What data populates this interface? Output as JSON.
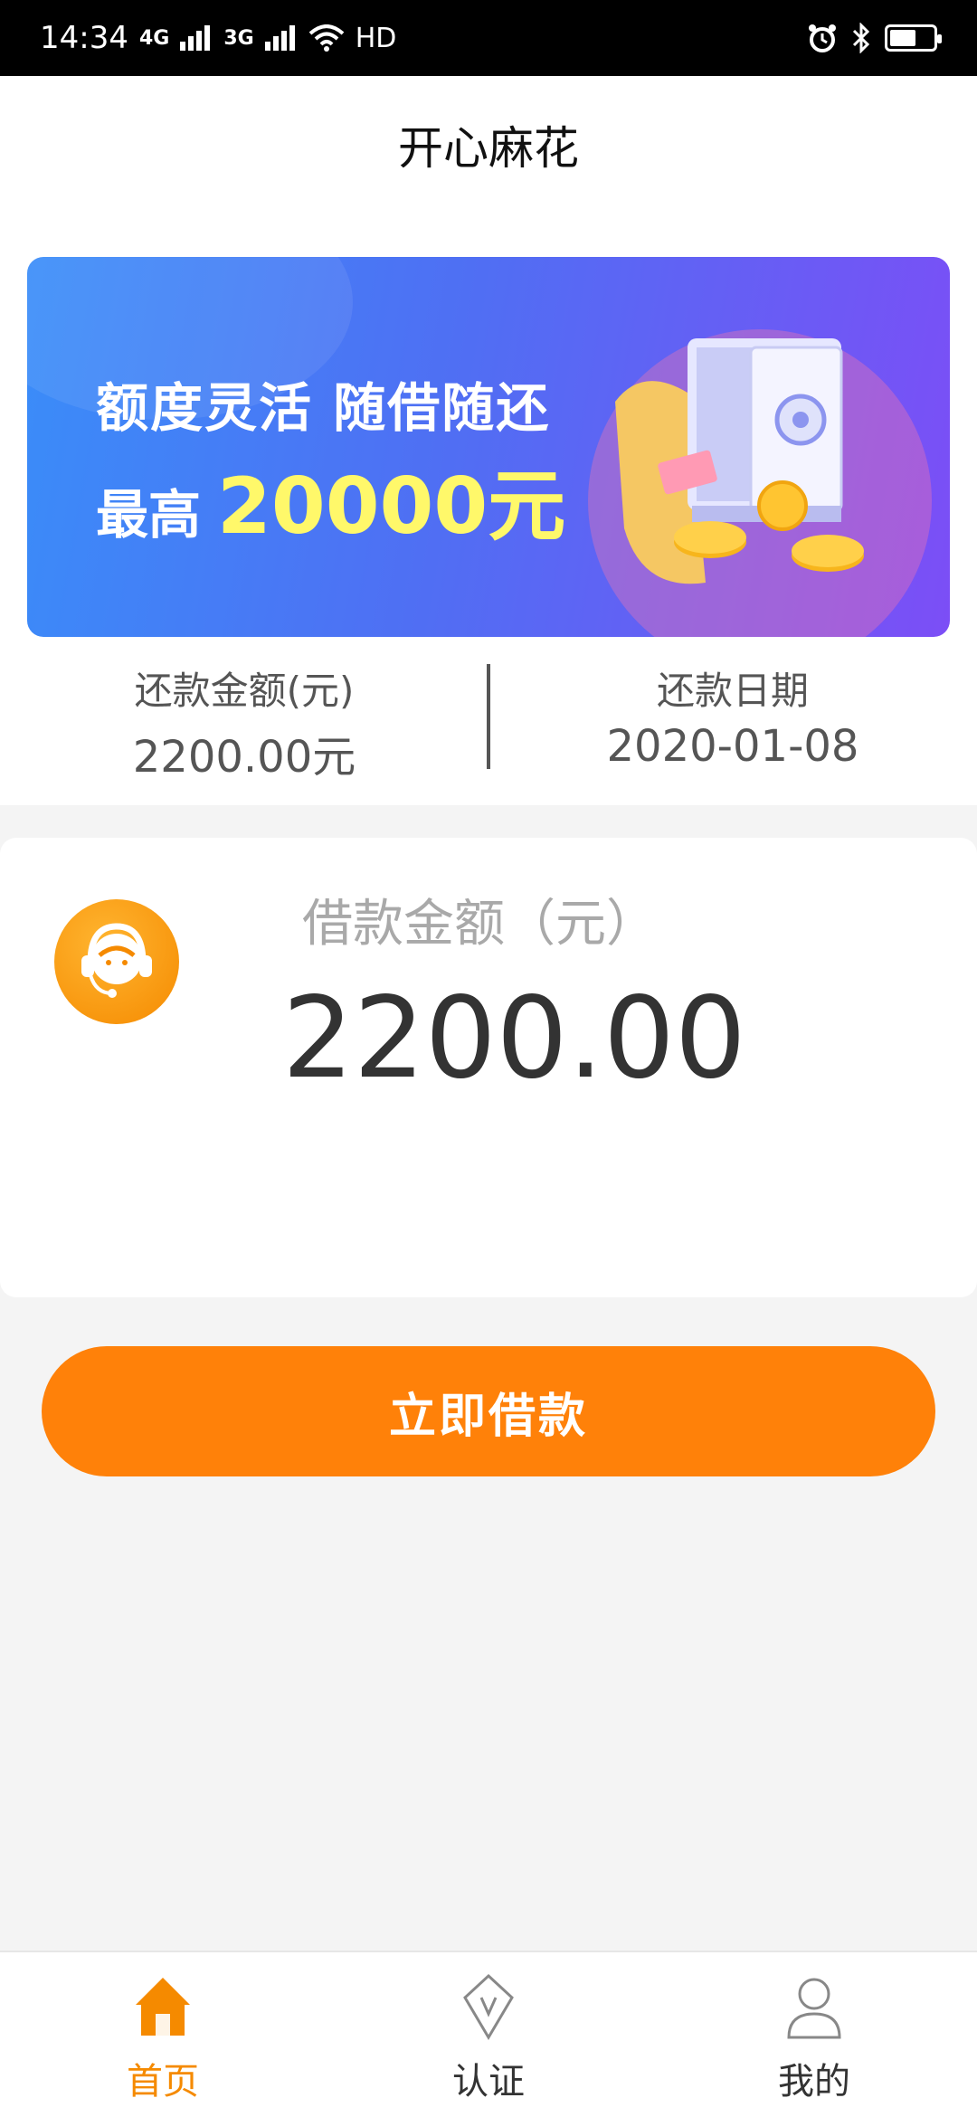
{
  "status_bar": {
    "time": "14:34",
    "network1": "4G",
    "network2": "3G",
    "hd": "HD",
    "battery_level": 0.6
  },
  "header": {
    "title": "开心麻花"
  },
  "banner": {
    "line1": "额度灵活 随借随还",
    "line2_prefix": "最高",
    "line2_amount": "20000元"
  },
  "summary": {
    "repay_amount_label": "还款金额(元)",
    "repay_amount_value": "2200.00元",
    "repay_date_label": "还款日期",
    "repay_date_value": "2020-01-08"
  },
  "loan": {
    "label": "借款金额（元）",
    "amount": "2200.00"
  },
  "action": {
    "borrow_label": "立即借款"
  },
  "tabbar": {
    "items": [
      {
        "label": "首页",
        "icon": "home-icon",
        "active": true
      },
      {
        "label": "认证",
        "icon": "verify-icon",
        "active": false
      },
      {
        "label": "我的",
        "icon": "user-icon",
        "active": false
      }
    ]
  },
  "colors": {
    "accent": "#ff8109",
    "tab_active": "#f58a00",
    "banner_highlight": "#fff86a"
  }
}
